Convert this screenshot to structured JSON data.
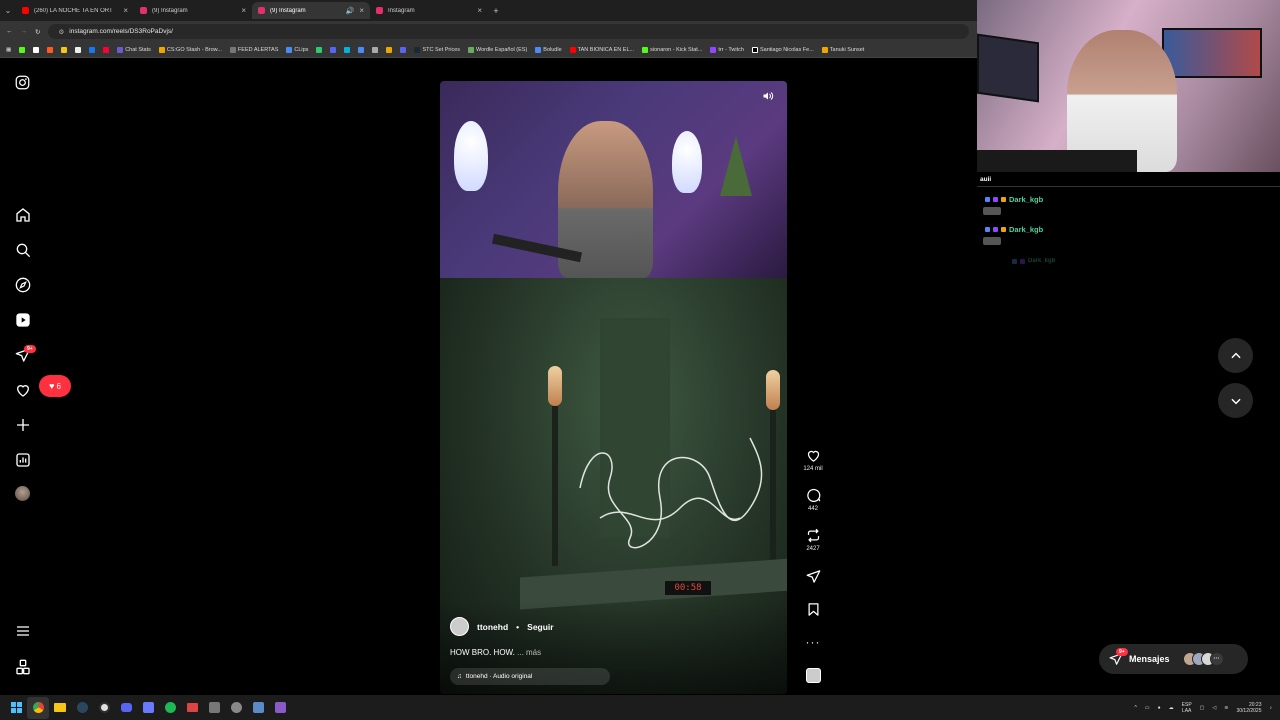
{
  "browser": {
    "tabs": [
      {
        "title": "(260) LA NOCHE TA EN ORT",
        "favicon_color": "#ff0000",
        "active": false
      },
      {
        "title": "(9) Instagram",
        "favicon_color": "#e1306c",
        "active": false
      },
      {
        "title": "(9) Instagram",
        "favicon_color": "#e1306c",
        "active": true
      },
      {
        "title": "Instagram",
        "favicon_color": "#e1306c",
        "active": false
      }
    ],
    "url": "instagram.com/reels/DS3RoPaDvjs/",
    "bookmarks": [
      "Chat Stats",
      "CS:GO Stash - Brow...",
      "FEED ALERTAS",
      "CLips",
      "STC Set Prices",
      "Wordle Español (ES)",
      "Boludle",
      "TAN BIONICA EN EL...",
      "sionaron - Kick Stat...",
      "trr - Twitch",
      "Santiago Nicolas Fe...",
      "Tanuki Sunset"
    ]
  },
  "sidebar": {
    "messages_badge": "9+",
    "notifications_count": "6"
  },
  "reel": {
    "username": "ttonehd",
    "separator": "•",
    "follow_label": "Seguir",
    "caption": "HOW BRO. HOW.",
    "caption_more": "... más",
    "audio": "ttonehd · Audio original",
    "timer": "00:58",
    "likes": "124 mil",
    "comments": "442",
    "reposts": "2427"
  },
  "messages": {
    "label": "Mensajes",
    "badge": "9+"
  },
  "chat": {
    "header": "auii",
    "messages": [
      {
        "user": "Dark_kgb",
        "faded": false
      },
      {
        "user": "Dark_kgb",
        "faded": false
      },
      {
        "user": "Dark_kgb",
        "faded": true
      }
    ]
  },
  "tray": {
    "lang_top": "ESP",
    "lang_bottom": "LAA",
    "time": "20:23",
    "date": "30/12/2025"
  },
  "colors": {
    "accent_red": "#ff3040",
    "chat_name": "#4fd3a0"
  }
}
